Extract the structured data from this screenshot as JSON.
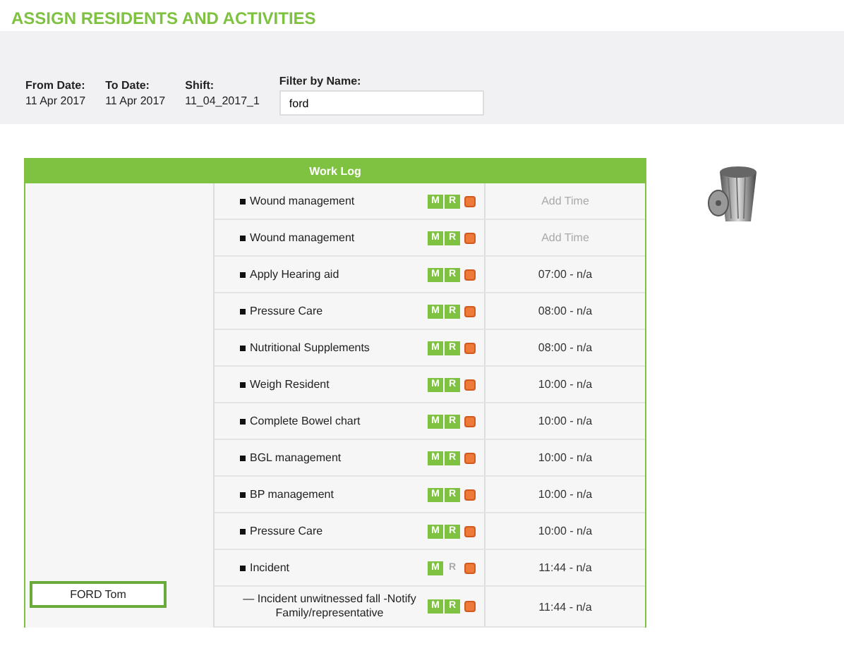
{
  "title": "ASSIGN RESIDENTS AND ACTIVITIES",
  "filters": {
    "fields": [
      {
        "label": "From Date:",
        "value": "11 Apr 2017"
      },
      {
        "label": "To Date:",
        "value": "11 Apr 2017"
      },
      {
        "label": "Shift:",
        "value": "11_04_2017_1"
      }
    ],
    "name_filter": {
      "label": "Filter by Name:",
      "value": "ford"
    }
  },
  "work_log": {
    "title": "Work Log",
    "resident": "FORD Tom",
    "rows": [
      {
        "kind": "task",
        "text": "Wound management",
        "m": "M",
        "r": "R",
        "r_enabled": true,
        "time": "Add Time",
        "time_set": false
      },
      {
        "kind": "task",
        "text": "Wound management",
        "m": "M",
        "r": "R",
        "r_enabled": true,
        "time": "Add Time",
        "time_set": false
      },
      {
        "kind": "task",
        "text": "Apply Hearing aid",
        "m": "M",
        "r": "R",
        "r_enabled": true,
        "time": "07:00 - n/a",
        "time_set": true
      },
      {
        "kind": "task",
        "text": "Pressure Care",
        "m": "M",
        "r": "R",
        "r_enabled": true,
        "time": "08:00 - n/a",
        "time_set": true
      },
      {
        "kind": "task",
        "text": "Nutritional Supplements",
        "m": "M",
        "r": "R",
        "r_enabled": true,
        "time": "08:00 - n/a",
        "time_set": true
      },
      {
        "kind": "task",
        "text": "Weigh Resident",
        "m": "M",
        "r": "R",
        "r_enabled": true,
        "time": "10:00 - n/a",
        "time_set": true
      },
      {
        "kind": "task",
        "text": "Complete Bowel chart",
        "m": "M",
        "r": "R",
        "r_enabled": true,
        "time": "10:00 - n/a",
        "time_set": true
      },
      {
        "kind": "task",
        "text": "BGL management",
        "m": "M",
        "r": "R",
        "r_enabled": true,
        "time": "10:00 - n/a",
        "time_set": true
      },
      {
        "kind": "task",
        "text": "BP management",
        "m": "M",
        "r": "R",
        "r_enabled": true,
        "time": "10:00 - n/a",
        "time_set": true
      },
      {
        "kind": "task",
        "text": "Pressure Care",
        "m": "M",
        "r": "R",
        "r_enabled": true,
        "time": "10:00 - n/a",
        "time_set": true
      },
      {
        "kind": "task",
        "text": "Incident",
        "m": "M",
        "r": "R",
        "r_enabled": false,
        "time": "11:44 - n/a",
        "time_set": true
      },
      {
        "kind": "sub",
        "text": "— Incident unwitnessed fall -Notify Family/representative",
        "m": "M",
        "r": "R",
        "r_enabled": true,
        "time": "11:44 - n/a",
        "time_set": true
      }
    ]
  }
}
